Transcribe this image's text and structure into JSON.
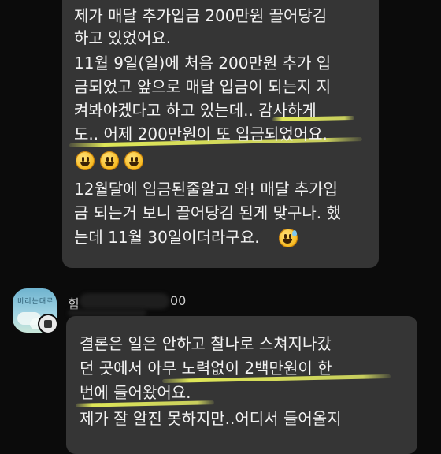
{
  "message1": {
    "lines": [
      "제가 매달 추가입금 200만원 끌어당김",
      "하고 있었어요.",
      " 11월 9일(일)에 처음 200만원 추가 입",
      "금되었고 앞으로 매달 입금이 되는지 지",
      "켜봐야겠다고 하고 있는데.. 감사하게",
      "도.. 어제 200만원이 또 입금되었어요.",
      "12월달에 입금된줄알고 와! 매달 추가입",
      "금 되는거 보니 끌어당김 된게 맞구나. 했",
      "는데 11월 30일이더라구요."
    ],
    "emoji_row": [
      "grinning-face",
      "grinning-face",
      "grinning-face"
    ],
    "trailing_emoji": "grinning-sweat-face"
  },
  "message2": {
    "sender_visible_start": "힘",
    "sender_visible_end": "00",
    "lines": [
      "결론은 일은 안하고 찰나로 스쳐지나갔",
      "던 곳에서 아무 노력없이 2백만원이 한",
      "번에 들어왔어요.",
      "제가 잘 알진 못하지만..어디서 들어올지"
    ]
  },
  "colors": {
    "background": "#0b0b0b",
    "bubble": "#353535",
    "highlight": "#e8f05a",
    "text": "#f3f3f3"
  }
}
